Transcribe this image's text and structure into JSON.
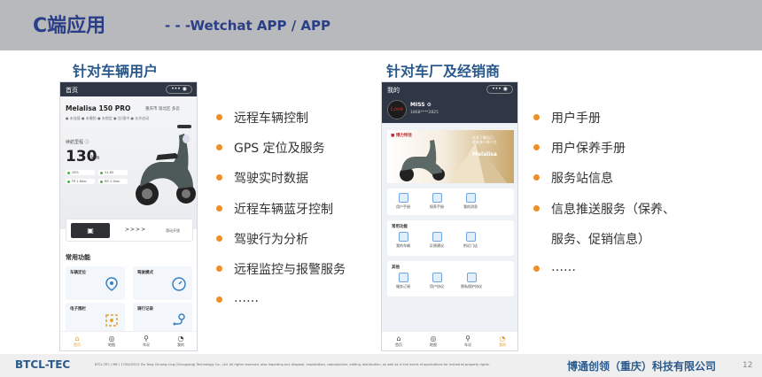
{
  "header": {
    "title": "C端应用",
    "subtitle": "- - -Wetchat APP / APP"
  },
  "left_section": {
    "title": "针对车辆用户"
  },
  "right_section": {
    "title": "针对车厂及经销商"
  },
  "phone1": {
    "topbar_title": "首页",
    "capsule": "••• ◉",
    "model": "Melalisa 150 PRO",
    "location": "重庆市 渝北区 多云",
    "status": "● 未连接  ● 未撤防  ● 未锁定  ● 告/报中  ● 允许启动",
    "range_label": "续航里程 ⓘ",
    "range_value": "130",
    "range_unit": "km",
    "chips": [
      "28%",
      "51.8V",
      "FR 1.8bar",
      "RR 2.5bar"
    ],
    "lock_icon": "lock-icon",
    "slide_arrows": ">>>>",
    "start_label": "滑动开锁",
    "functions_label": "常用功能",
    "cards": [
      "车辆定位",
      "驾驶模式",
      "电子围栏",
      "骑行记录"
    ],
    "tabs": [
      "首页",
      "地图",
      "车况",
      "我的"
    ]
  },
  "phone2": {
    "topbar_title": "我的",
    "capsule": "••• ◉",
    "avatar_text": "Love",
    "user_name": "MISS ⚙",
    "user_phone": "1868****2825",
    "banner_logo": "■ 博力特佳",
    "banner_slogan": "在多了解自己\n就有多少种人生",
    "banner_brand": "Melalisa",
    "panel1_items": [
      "用户手册",
      "保养手册",
      "我的消息"
    ],
    "panel2_title": "常用功能",
    "panel2_items": [
      "我的车辆",
      "反馈建议",
      "附近门店"
    ],
    "panel3_title": "其他",
    "panel3_items": [
      "服务订阅",
      "用户协议",
      "隐私保护协议"
    ],
    "tabs": [
      "首页",
      "地图",
      "车况",
      "我的"
    ]
  },
  "left_bullets": [
    "远程车辆控制",
    "GPS 定位及服务",
    "驾驶实时数据",
    "近程车辆蓝牙控制",
    "驾驶行为分析",
    "远程监控与报警服务",
    "……"
  ],
  "right_bullets": [
    "用户手册",
    "用户保养手册",
    "服务站信息",
    "信息推送服务（保养、",
    "服务、促销信息）",
    "……"
  ],
  "footer": {
    "left": "BTCL-TEC",
    "small": "BTCL-TEC / MK / 17/04/2023. Bo Tong Chuang Ling (Chongqing) Technology Co., Ltd.  All rights reserved. also regarding any disposal, exploitation, reproduction, editing, distribution, as well as in the event of applications for industrial property rights.",
    "right": "博通创领（重庆）科技有限公司",
    "page": "12"
  },
  "colors": {
    "accent": "#ee8f27",
    "title_blue": "#2b3f88",
    "section_blue": "#2a5a8c",
    "header_gray": "#b8b9bc",
    "phone_dark": "#2f3747"
  }
}
